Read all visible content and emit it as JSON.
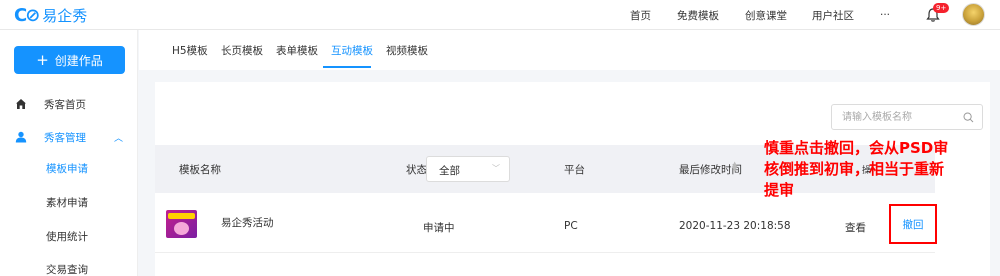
{
  "brand": {
    "logo_mark": "C⊘",
    "name": "易企秀"
  },
  "topnav": {
    "items": [
      "首页",
      "免费模板",
      "创意课堂",
      "用户社区",
      "···"
    ],
    "badge": "9+",
    "icons": [
      "bell-icon",
      "avatar"
    ]
  },
  "sidebar": {
    "create_label": "创建作品",
    "items": [
      {
        "label": "秀客首页",
        "icon": "home-icon"
      },
      {
        "label": "秀客管理",
        "icon": "user-icon",
        "expanded": true
      }
    ],
    "sub_items": [
      "模板申请",
      "素材申请",
      "使用统计",
      "交易查询"
    ],
    "active_sub": "模板申请"
  },
  "tabs": {
    "items": [
      "H5模板",
      "长页模板",
      "表单模板",
      "互动模板",
      "视频模板"
    ],
    "active": "互动模板"
  },
  "search": {
    "placeholder": "请输入模板名称"
  },
  "table": {
    "headers": {
      "name": "模板名称",
      "status": "状态",
      "platform": "平台",
      "modified": "最后修改时间",
      "action_cut": "操"
    },
    "status_filter": "全部",
    "rows": [
      {
        "name": "易企秀活动",
        "status": "申请中",
        "platform": "PC",
        "modified": "2020-11-23 20:18:58",
        "view": "查看",
        "withdraw": "撤回"
      }
    ]
  },
  "annotation": {
    "lines": [
      "慎重点击撤回，会从PSD审",
      "核倒推到初审，相当于重新",
      "提审"
    ],
    "color": "#ff0000"
  },
  "colors": {
    "accent": "#1593ff",
    "annotation": "#ff0000",
    "badge": "#f5222d"
  }
}
